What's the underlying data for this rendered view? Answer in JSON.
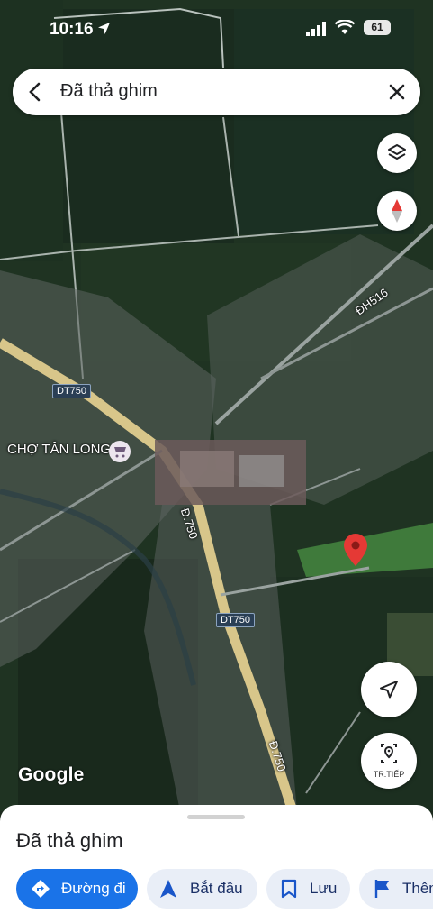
{
  "status_bar": {
    "time": "10:16",
    "battery": "61"
  },
  "search": {
    "query": "Đã thả ghim"
  },
  "map": {
    "labels": {
      "market": "CHỢ TÂN LONG",
      "road_dt750_a": "DT750",
      "road_dt750_b": "DT750",
      "road_dt750_c": "Đ.750",
      "road_dt750_d": "Đ.750",
      "road_dh516": "ĐH516"
    },
    "street_view_label": "TR.TIẾP",
    "logo": "Google"
  },
  "bottom_sheet": {
    "title": "Đã thả ghim",
    "actions": [
      {
        "label": "Đường đi"
      },
      {
        "label": "Bắt đầu"
      },
      {
        "label": "Lưu"
      },
      {
        "label": "Thêm"
      }
    ]
  },
  "colors": {
    "accent": "#1a73e8",
    "pin": "#e53935"
  }
}
